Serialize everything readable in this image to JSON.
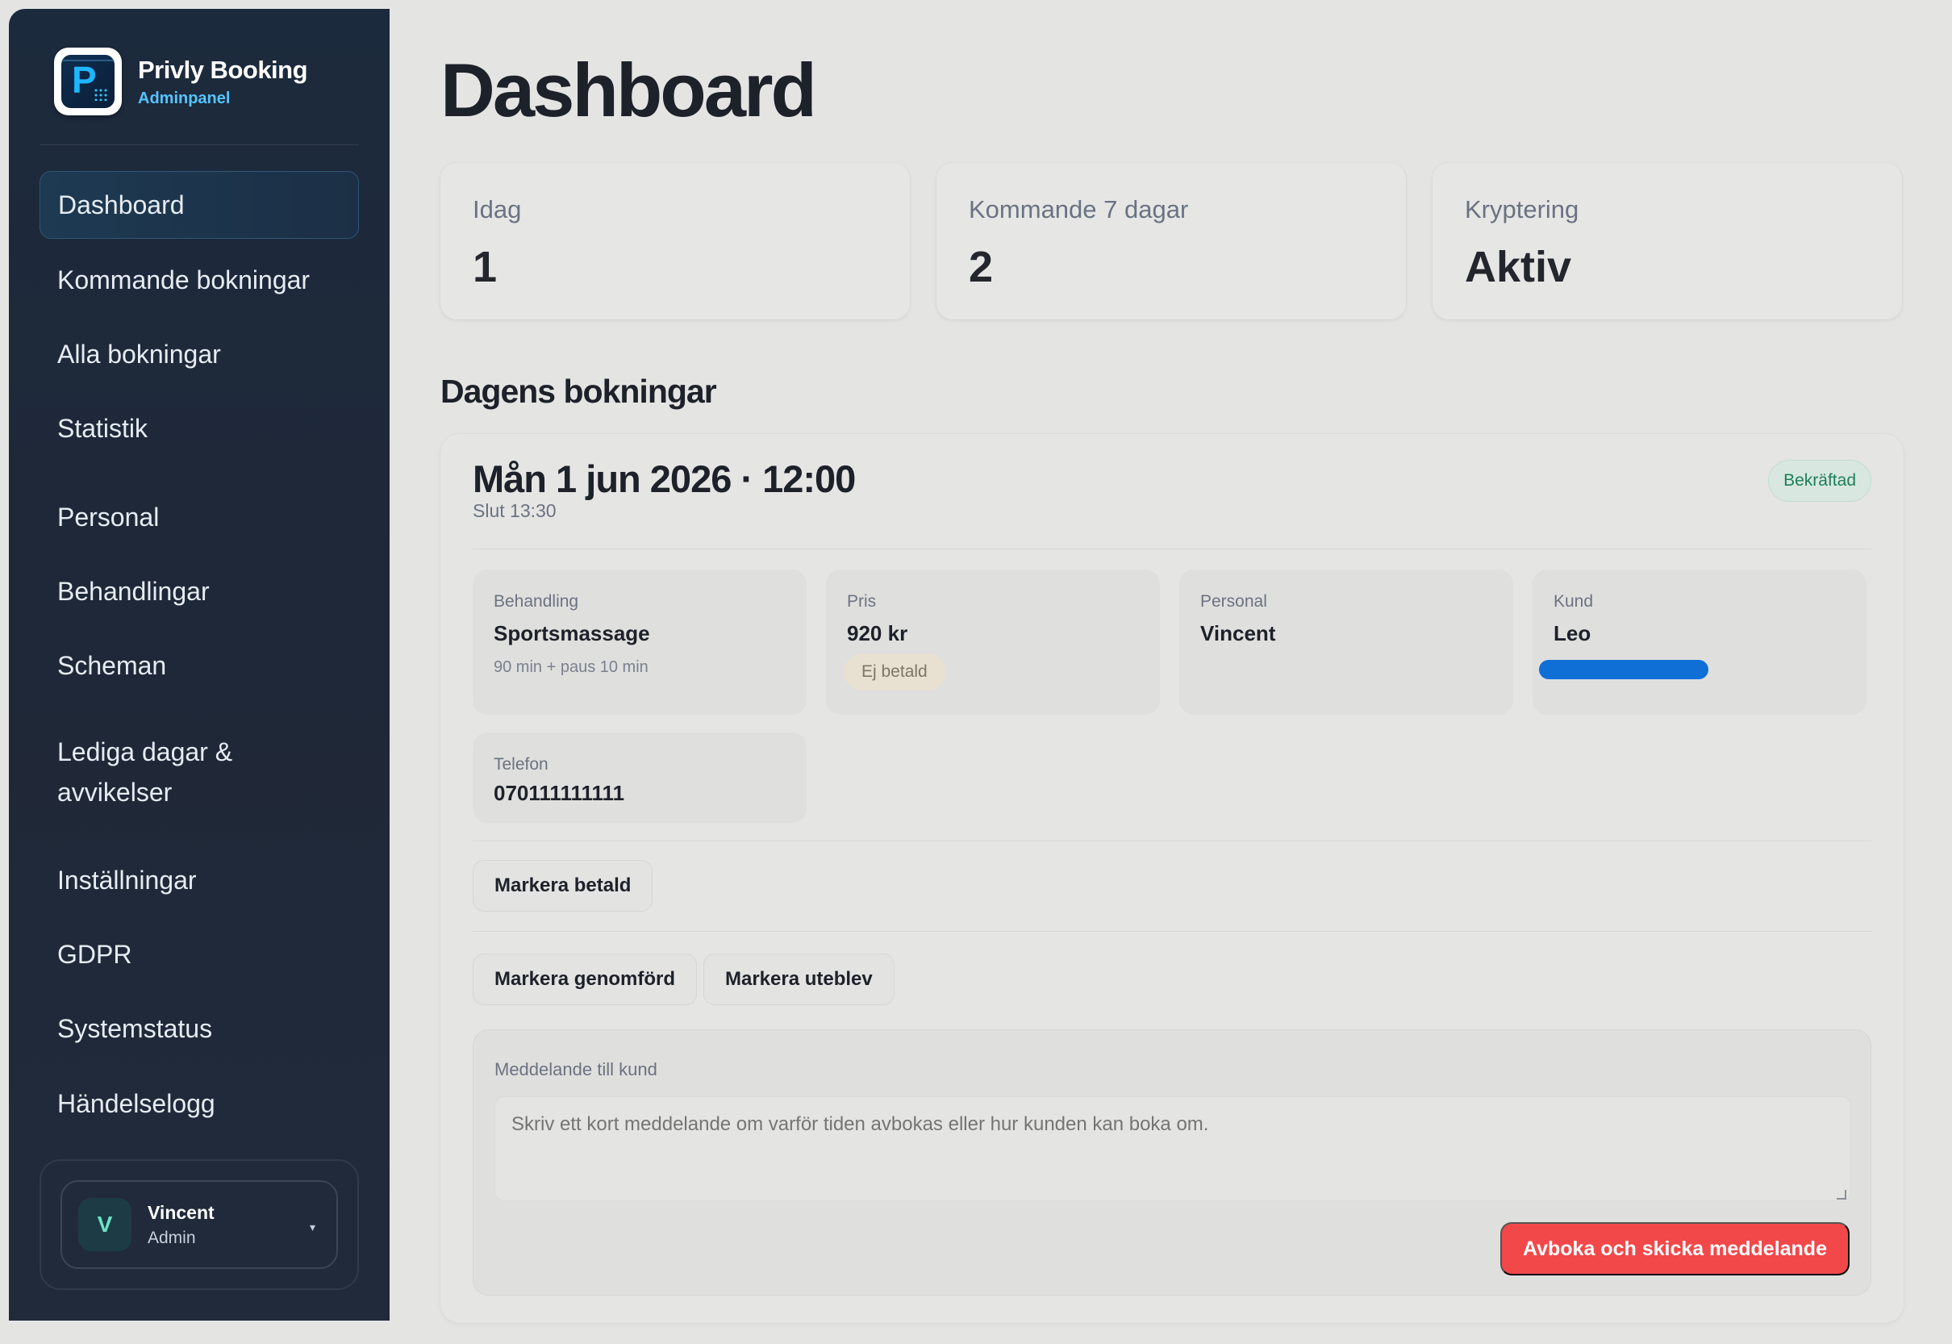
{
  "brand": {
    "title": "Privly Booking",
    "subtitle": "Adminpanel",
    "logo_letter": "P"
  },
  "nav": {
    "items": [
      {
        "label": "Dashboard",
        "active": true
      },
      {
        "label": "Kommande bokningar"
      },
      {
        "label": "Alla bokningar"
      },
      {
        "label": "Statistik"
      },
      {
        "label": "Personal"
      },
      {
        "label": "Behandlingar"
      },
      {
        "label": "Scheman"
      },
      {
        "label": "Lediga dagar & avvikelser"
      },
      {
        "label": "Inställningar"
      },
      {
        "label": "GDPR"
      },
      {
        "label": "Systemstatus"
      },
      {
        "label": "Händelselogg"
      }
    ]
  },
  "user": {
    "initial": "V",
    "name": "Vincent",
    "role": "Admin",
    "caret": "▾"
  },
  "page": {
    "title": "Dashboard"
  },
  "stats": [
    {
      "label": "Idag",
      "value": "1"
    },
    {
      "label": "Kommande 7 dagar",
      "value": "2"
    },
    {
      "label": "Kryptering",
      "value": "Aktiv"
    }
  ],
  "section": {
    "title": "Dagens bokningar"
  },
  "booking": {
    "datetime": "Mån 1 jun 2026 · 12:00",
    "end": "Slut 13:30",
    "status": "Bekräftad",
    "treatment": {
      "label": "Behandling",
      "value": "Sportsmassage",
      "sub": "90 min + paus 10 min"
    },
    "price": {
      "label": "Pris",
      "value": "920 kr",
      "paid_status": "Ej betald"
    },
    "staff": {
      "label": "Personal",
      "value": "Vincent"
    },
    "customer": {
      "label": "Kund",
      "value": "Leo"
    },
    "phone": {
      "label": "Telefon",
      "value": "070111111111"
    },
    "actions": {
      "mark_paid": "Markera betald",
      "mark_done": "Markera genomförd",
      "mark_noshow": "Markera uteblev"
    },
    "message": {
      "label": "Meddelande till kund",
      "placeholder": "Skriv ett kort meddelande om varför tiden avbokas eller hur kunden kan boka om.",
      "submit": "Avboka och skicka meddelande"
    }
  },
  "colors": {
    "sidebar": "#1f2838",
    "accent": "#56c4ff",
    "status_confirmed": "#1c7f59",
    "danger": "#f2484a"
  }
}
